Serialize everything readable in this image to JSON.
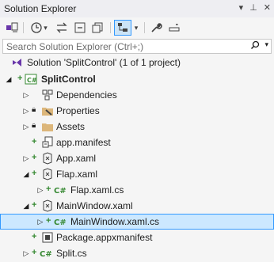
{
  "window": {
    "title": "Solution Explorer"
  },
  "search": {
    "placeholder": "Search Solution Explorer (Ctrl+;)"
  },
  "tree": {
    "solution": "Solution 'SplitControl' (1 of 1 project)",
    "project": "SplitControl",
    "items": [
      {
        "label": "Dependencies"
      },
      {
        "label": "Properties"
      },
      {
        "label": "Assets"
      },
      {
        "label": "app.manifest"
      },
      {
        "label": "App.xaml"
      },
      {
        "label": "Flap.xaml"
      },
      {
        "label": "Flap.xaml.cs"
      },
      {
        "label": "MainWindow.xaml"
      },
      {
        "label": "MainWindow.xaml.cs"
      },
      {
        "label": "Package.appxmanifest"
      },
      {
        "label": "Split.cs"
      }
    ]
  },
  "colors": {
    "accent": "#3399ff",
    "selected_bg": "#cce8ff",
    "added_plus": "#388a34",
    "csharp": "#388a34",
    "folder": "#dcb67a"
  }
}
